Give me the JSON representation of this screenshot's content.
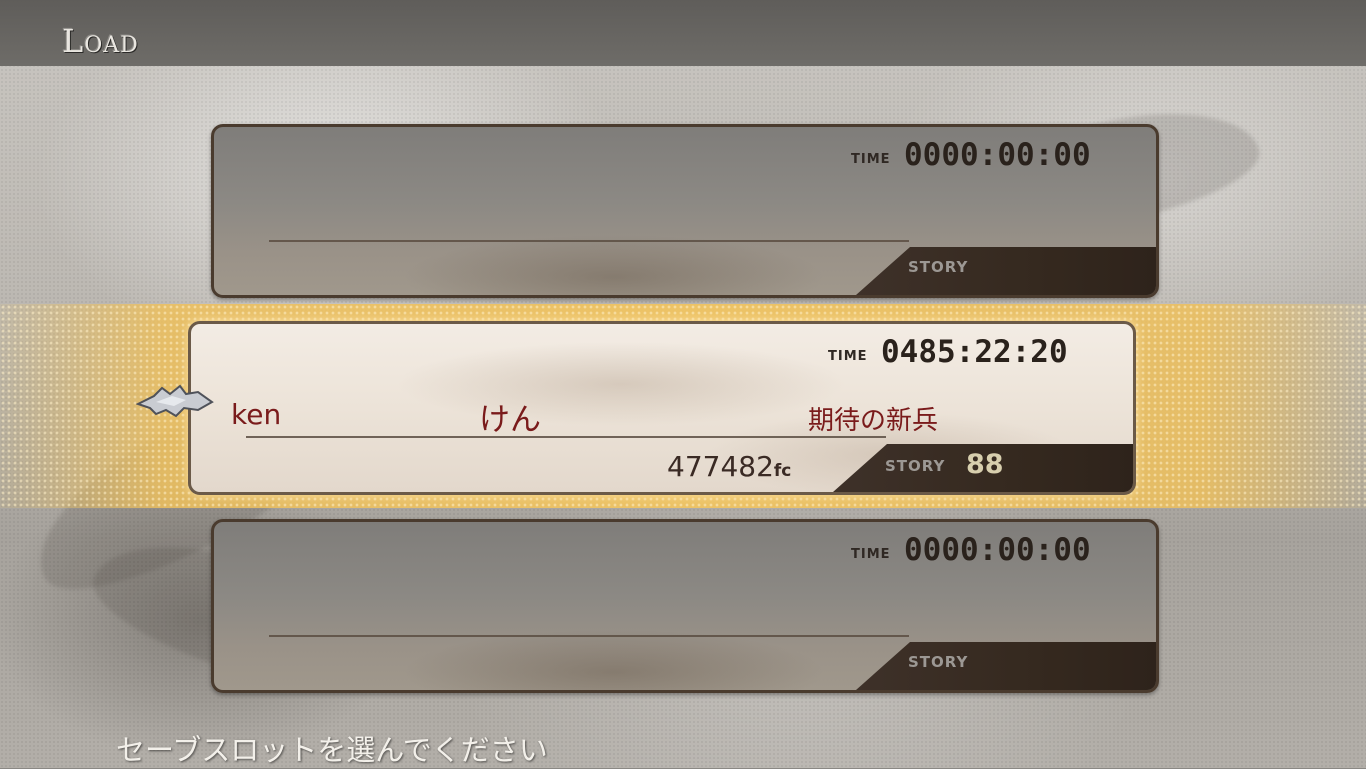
{
  "header": {
    "title": "Load"
  },
  "slots": [
    {
      "time_label": "TIME",
      "time": "0000:00:00",
      "story_label": "STORY"
    },
    {
      "time_label": "TIME",
      "time": "0485:22:20",
      "story_label": "STORY",
      "story": "88",
      "player_name": "ken",
      "character_name": "けん",
      "title": "期待の新兵",
      "gold": "477482",
      "gold_unit": "fc"
    },
    {
      "time_label": "TIME",
      "time": "0000:00:00",
      "story_label": "STORY"
    }
  ],
  "footer": {
    "hint": "セーブスロットを選んでください"
  },
  "colors": {
    "highlight": "#f0c462",
    "panel_border": "#4a3b2e",
    "text_red": "#7a1b1b"
  },
  "icons": {
    "cursor": "wing-cursor-icon"
  }
}
